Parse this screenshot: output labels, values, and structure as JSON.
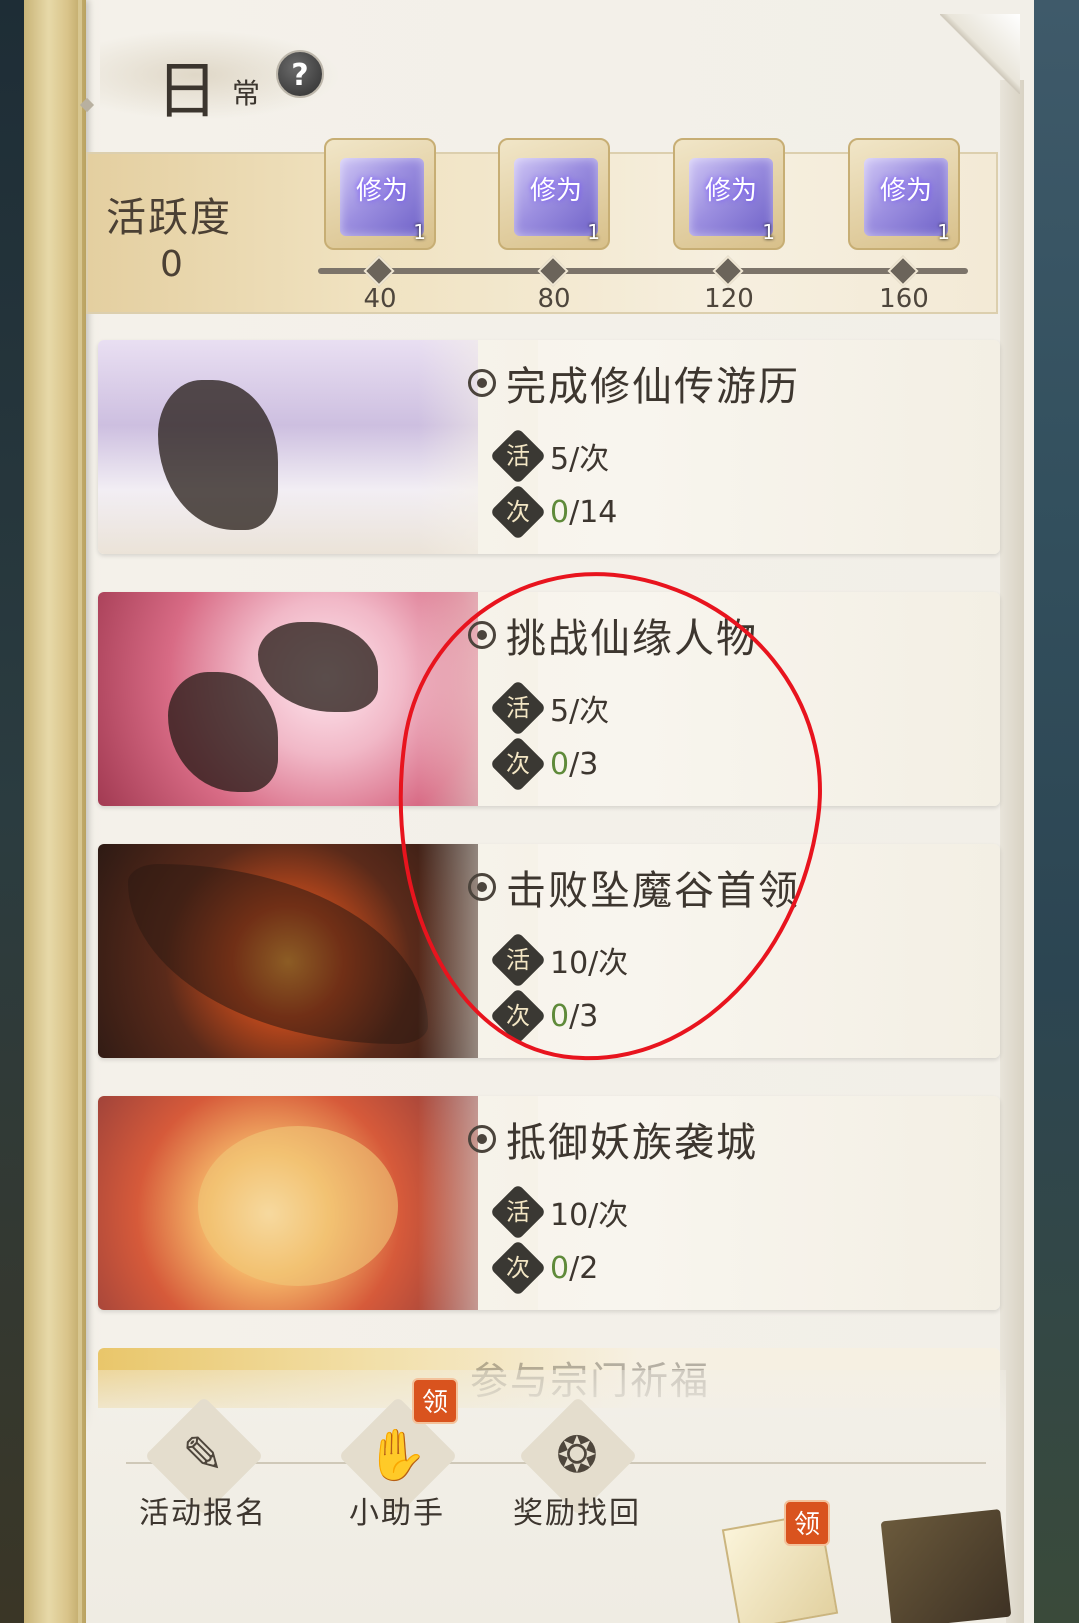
{
  "header": {
    "title_main": "日",
    "title_sub": "常",
    "help_icon_glyph": "?"
  },
  "activity": {
    "label": "活跃度",
    "value": "0",
    "milestones": [
      {
        "threshold": "40",
        "reward_glyph": "修为",
        "count": "1"
      },
      {
        "threshold": "80",
        "reward_glyph": "修为",
        "count": "1"
      },
      {
        "threshold": "120",
        "reward_glyph": "修为",
        "count": "1"
      },
      {
        "threshold": "160",
        "reward_glyph": "修为",
        "count": "1"
      }
    ]
  },
  "tasks": [
    {
      "title": "完成修仙传游历",
      "activity_badge": "活",
      "activity_value": "5/次",
      "count_badge": "次",
      "count_current": "0",
      "count_total": "/14"
    },
    {
      "title": "挑战仙缘人物",
      "activity_badge": "活",
      "activity_value": "5/次",
      "count_badge": "次",
      "count_current": "0",
      "count_total": "/3"
    },
    {
      "title": "击败坠魔谷首领",
      "activity_badge": "活",
      "activity_value": "10/次",
      "count_badge": "次",
      "count_current": "0",
      "count_total": "/3"
    },
    {
      "title": "抵御妖族袭城",
      "activity_badge": "活",
      "activity_value": "10/次",
      "count_badge": "次",
      "count_current": "0",
      "count_total": "/2"
    },
    {
      "title": "参与宗门祈福"
    }
  ],
  "bottom_nav": {
    "items": [
      {
        "label": "活动报名",
        "icon": "signup-form-icon"
      },
      {
        "label": "小助手",
        "icon": "helper-handshake-icon",
        "badge": "领"
      },
      {
        "label": "奖励找回",
        "icon": "reward-bag-icon"
      }
    ],
    "mail_badge": "领"
  },
  "colors": {
    "annotation": "#e8141e",
    "count_current": "#5f8a3a",
    "claim_badge": "#d9531e"
  }
}
